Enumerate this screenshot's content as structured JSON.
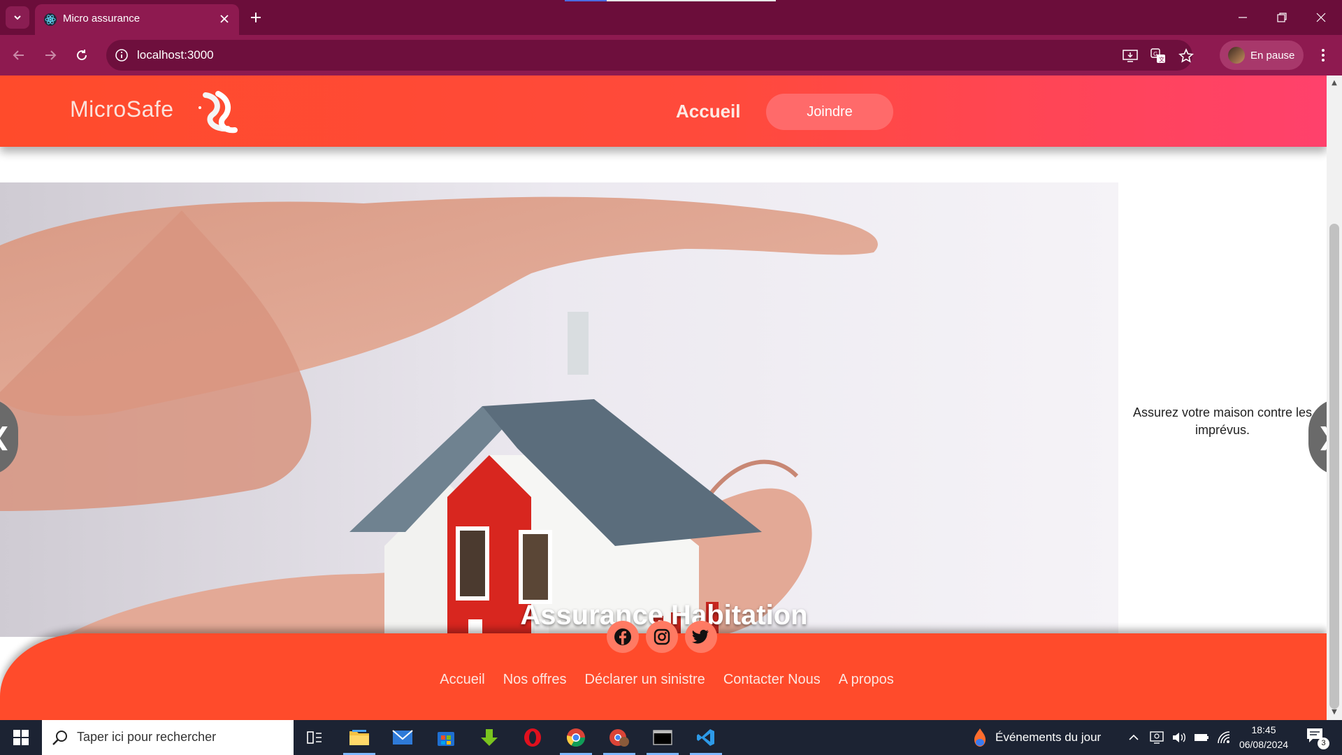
{
  "browser": {
    "tab_title": "Micro assurance",
    "url": "localhost:3000",
    "profile_label": "En pause",
    "accent": "#6b0d3a"
  },
  "site": {
    "brand": "MicroSafe",
    "nav_home": "Accueil",
    "join_label": "Joindre",
    "slide": {
      "title": "Assurance Habitation",
      "description": "Assurez votre maison contre les imprévus."
    },
    "carousel_prev": "❮",
    "carousel_next": "❯",
    "footer_links": [
      "Accueil",
      "Nos offres",
      "Déclarer un sinistre",
      "Contacter Nous",
      "A propos"
    ],
    "socials": [
      "facebook-icon",
      "instagram-icon",
      "twitter-icon"
    ],
    "colors": {
      "header_start": "#ff4b2b",
      "header_end": "#ff416c",
      "footer": "#ff4b2b"
    }
  },
  "taskbar": {
    "search_placeholder": "Taper ici pour rechercher",
    "events_label": "Événements du jour",
    "time": "18:45",
    "date": "06/08/2024",
    "notification_count": "3"
  }
}
